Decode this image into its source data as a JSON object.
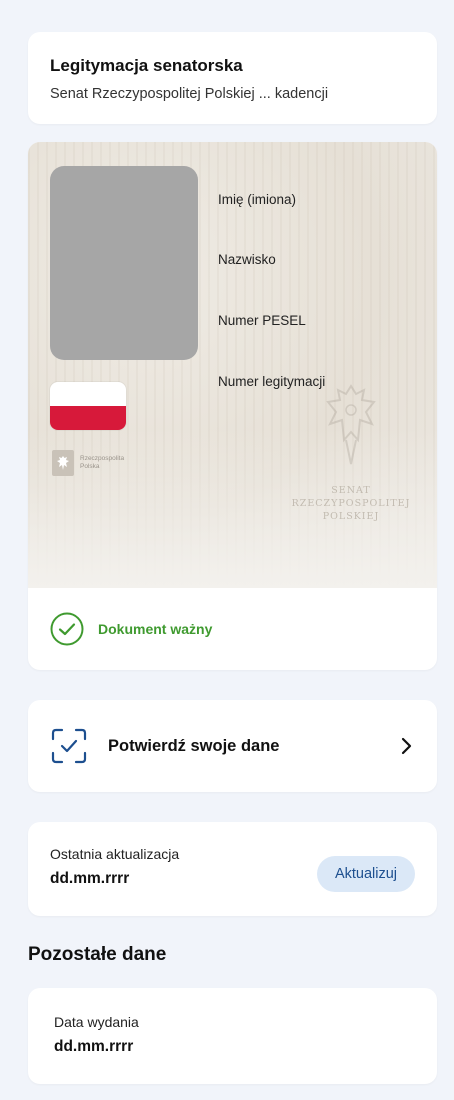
{
  "document": {
    "title": "Legitymacja senatorska",
    "subtitle": "Senat Rzeczypospolitej Polskiej ... kadencji"
  },
  "id_card": {
    "fields": [
      "Imię (imiona)",
      "Nazwisko",
      "Numer PESEL",
      "Numer legitymacji"
    ],
    "emblem_text": "Rzeczpospolita\nPolska",
    "watermark_text": "SENAT\nRZECZYPOSPOLITEJ\nPOLSKIEJ",
    "flag_colors": [
      "#ffffff",
      "#d7193a"
    ],
    "status": "Dokument ważny",
    "status_color": "#3f9a2f"
  },
  "confirm": {
    "label": "Potwierdź swoje dane"
  },
  "update": {
    "label": "Ostatnia aktualizacja",
    "value": "dd.mm.rrrr",
    "button": "Aktualizuj"
  },
  "other": {
    "section_title": "Pozostałe dane",
    "issue_label": "Data wydania",
    "issue_value": "dd.mm.rrrr"
  },
  "colors": {
    "background": "#f1f4fa",
    "accent_blue": "#1d4f8f",
    "button_bg": "#dbe8f7"
  }
}
